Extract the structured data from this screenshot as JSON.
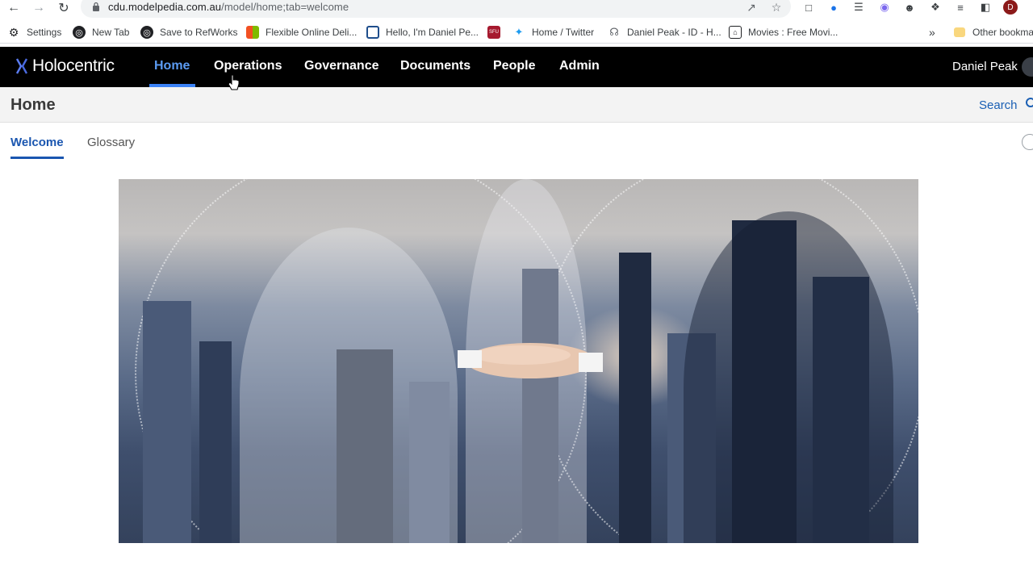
{
  "browser": {
    "url_host": "cdu.modelpedia.com.au",
    "url_path": "/model/home;tab=welcome",
    "bookmarks": [
      {
        "label": "Settings",
        "icon": "gear-icon"
      },
      {
        "label": "New Tab",
        "icon": "globe-icon"
      },
      {
        "label": "Save to RefWorks",
        "icon": "globe-icon"
      },
      {
        "label": "Flexible Online Deli...",
        "icon": "windows-icon"
      },
      {
        "label": "Hello, I'm Daniel Pe...",
        "icon": "page-icon"
      },
      {
        "label": "",
        "icon": "sfu-icon"
      },
      {
        "label": "Home / Twitter",
        "icon": "twitter-icon"
      },
      {
        "label": "Daniel Peak - ID - H...",
        "icon": "fingerprint-icon"
      },
      {
        "label": "Movies : Free Movi...",
        "icon": "archive-icon"
      }
    ],
    "overflow": "»",
    "other_bookmarks": "Other bookma",
    "sfu_badge": "SFU"
  },
  "app": {
    "logo_text": "Holocentric",
    "nav": [
      {
        "label": "Home"
      },
      {
        "label": "Operations"
      },
      {
        "label": "Governance"
      },
      {
        "label": "Documents"
      },
      {
        "label": "People"
      },
      {
        "label": "Admin"
      }
    ],
    "user_name": "Daniel Peak",
    "accent_color": "#3b82f6"
  },
  "page": {
    "title": "Home",
    "search_label": "Search",
    "tabs": [
      {
        "label": "Welcome",
        "active": true
      },
      {
        "label": "Glossary",
        "active": false
      }
    ]
  },
  "hero": {
    "description_icon": "hero-image"
  }
}
